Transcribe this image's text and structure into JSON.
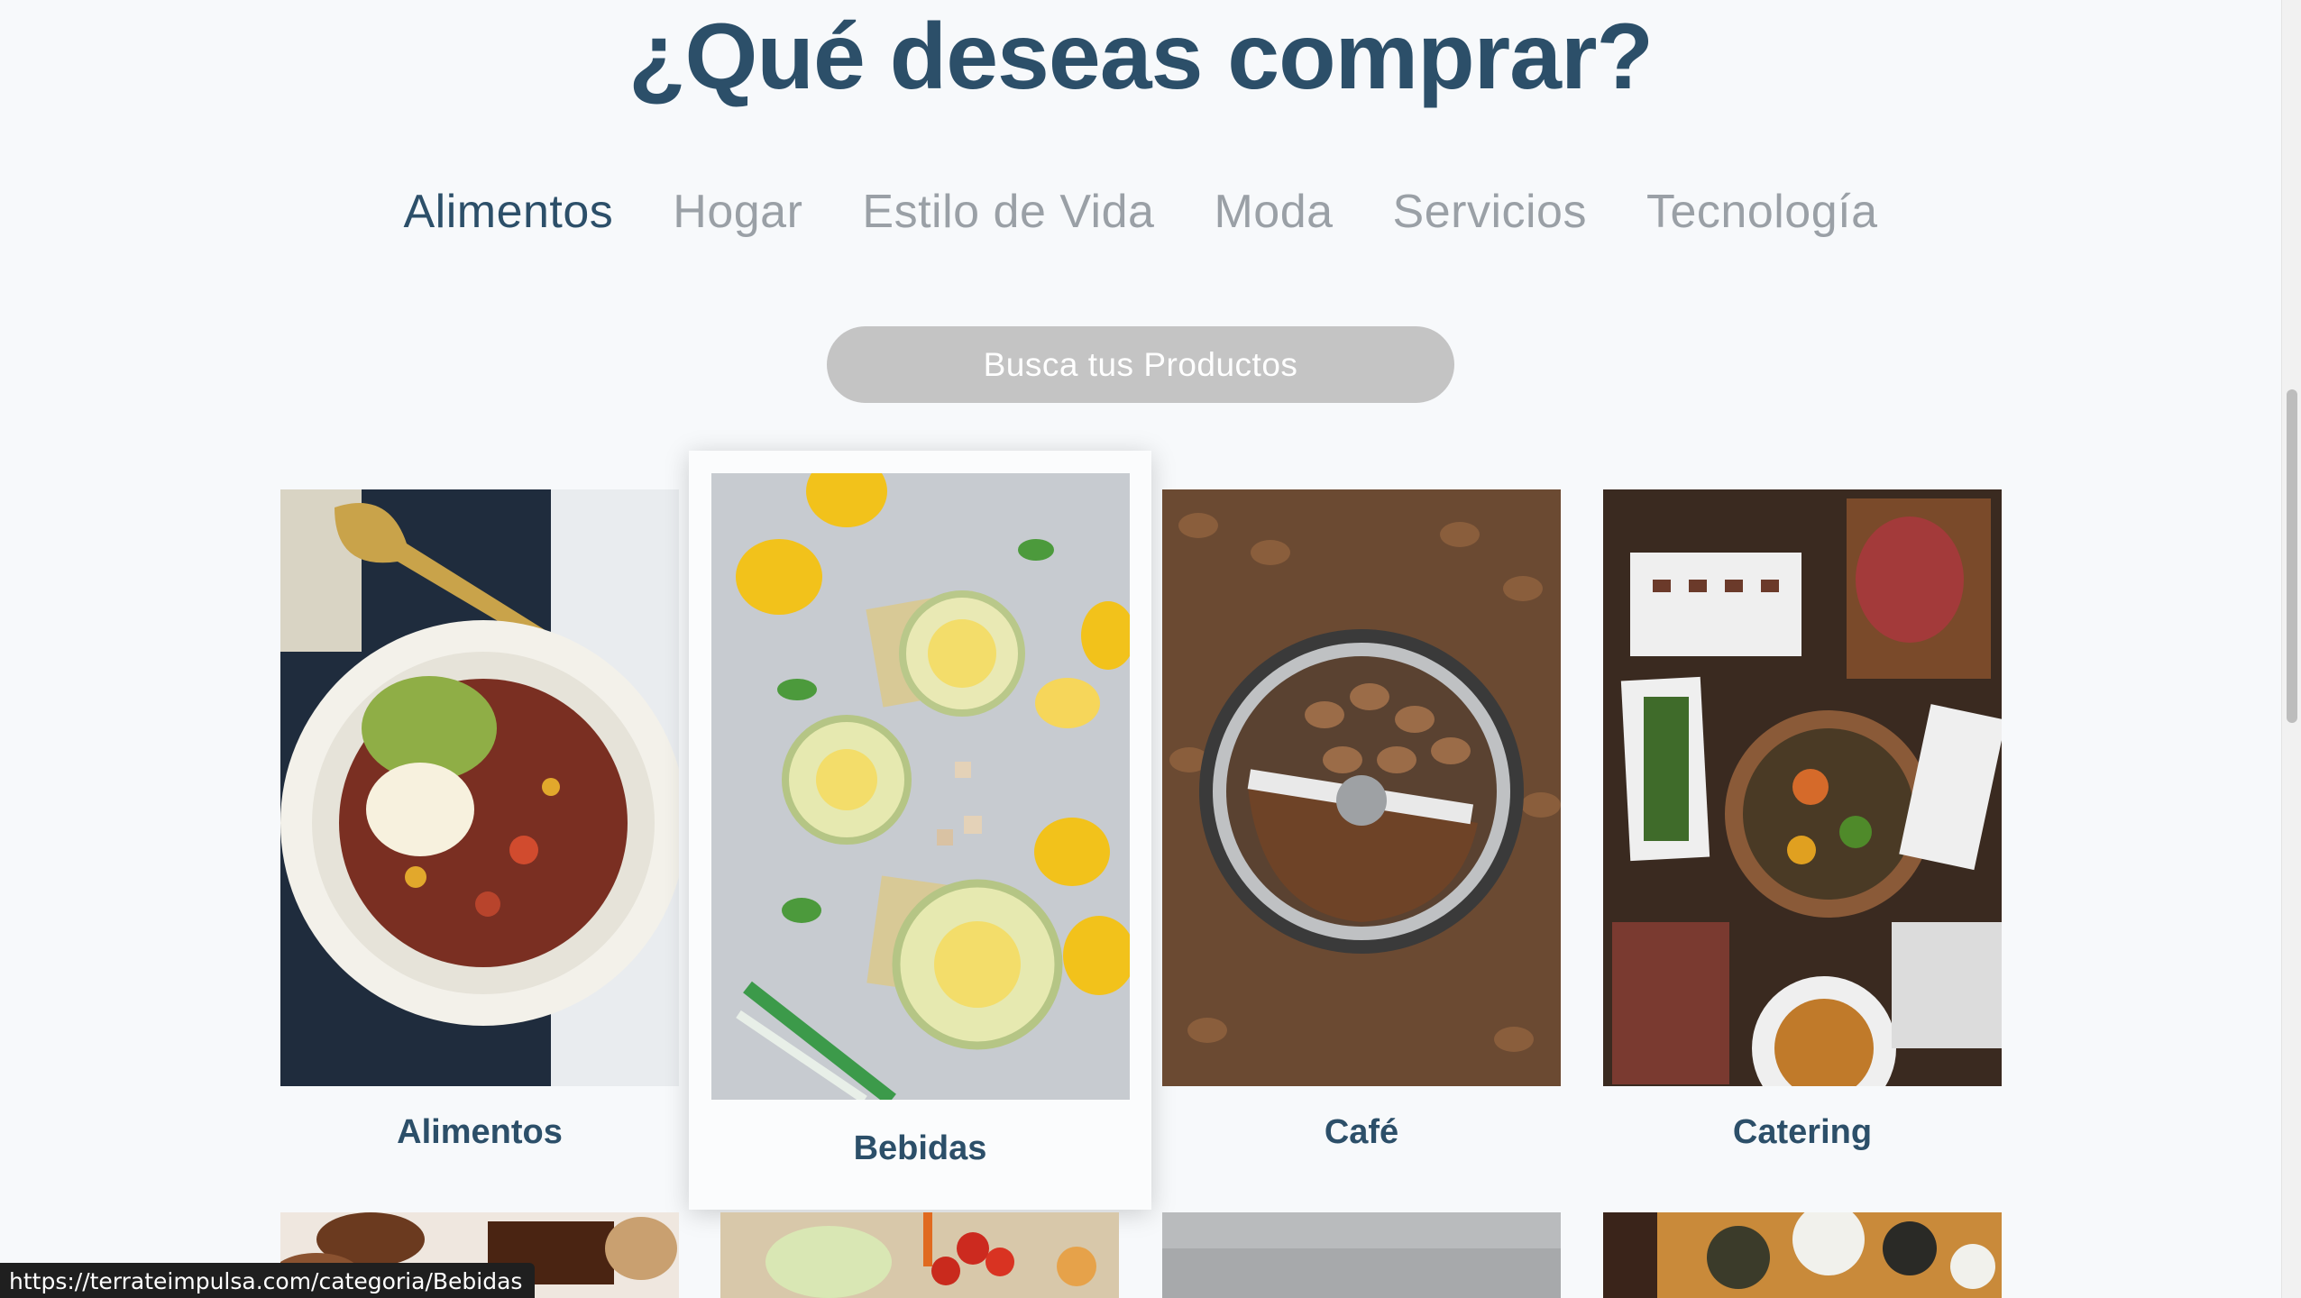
{
  "heading": "¿Qué deseas comprar?",
  "tabs": [
    {
      "label": "Alimentos",
      "active": true
    },
    {
      "label": "Hogar",
      "active": false
    },
    {
      "label": "Estilo de Vida",
      "active": false
    },
    {
      "label": "Moda",
      "active": false
    },
    {
      "label": "Servicios",
      "active": false
    },
    {
      "label": "Tecnología",
      "active": false
    }
  ],
  "search": {
    "label": "Busca tus Productos"
  },
  "categories": [
    {
      "label": "Alimentos",
      "image": "chili-bowl-image"
    },
    {
      "label": "Bebidas",
      "image": "lemonade-image"
    },
    {
      "label": "Café",
      "image": "coffee-grinder-image"
    },
    {
      "label": "Catering",
      "image": "catering-table-image"
    }
  ],
  "status_url": "https://terrateimpulsa.com/categoria/Bebidas",
  "colors": {
    "accent": "#2c4f69",
    "tab_inactive": "#9aa0a6",
    "search_bg": "#c4c4c4"
  }
}
